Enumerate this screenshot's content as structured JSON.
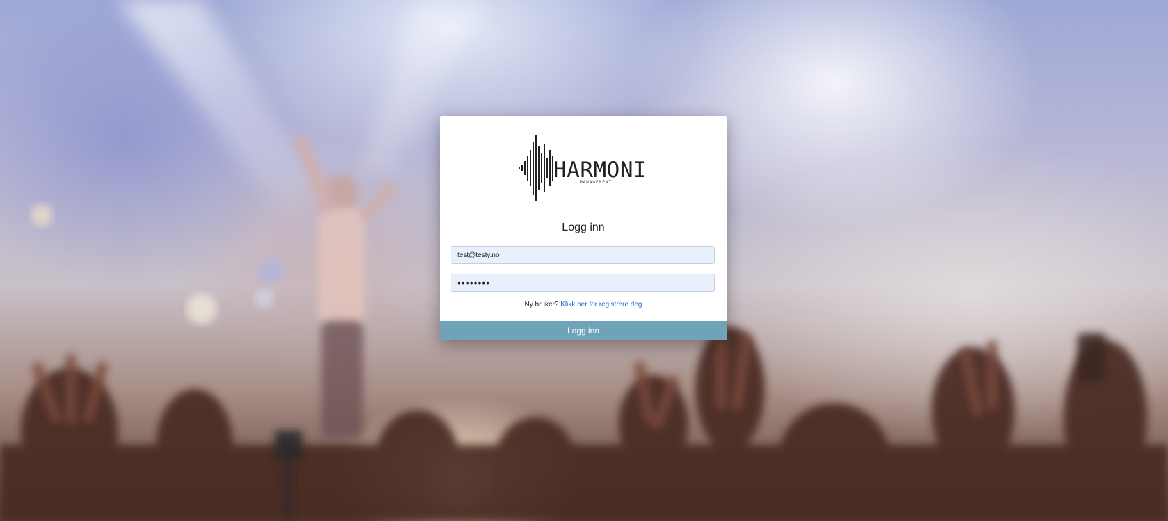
{
  "brand": {
    "name": "HARMONI",
    "tagline": "MANAGEMENT",
    "logo_icon": "soundwave-icon"
  },
  "login": {
    "title": "Logg inn",
    "email_value": "test@testy.no",
    "password_value": "••••••••",
    "register_prompt": "Ny bruker?",
    "register_link": "Klikk her for registrere deg",
    "submit_label": "Logg inn"
  },
  "colors": {
    "button_bg": "#6fa4b8",
    "link": "#1a6fd6",
    "autofill_bg": "#e8f0fe"
  }
}
